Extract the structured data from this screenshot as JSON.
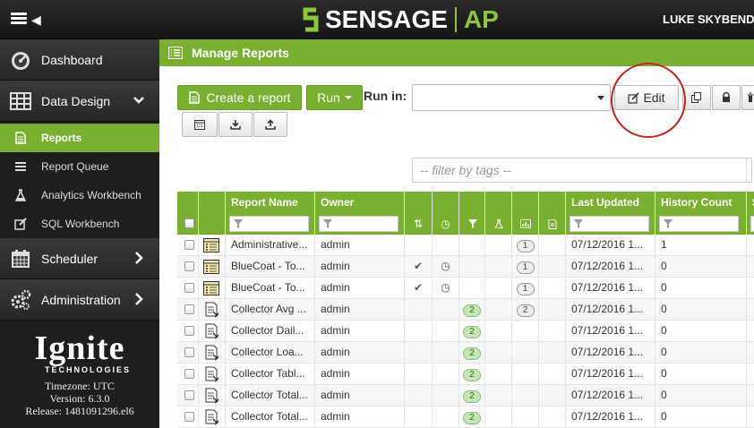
{
  "topbar": {
    "brand_main": "SENSAGE",
    "brand_suffix": "AP",
    "user_name": "LUKE SKYBENDER",
    "menu_icon": "hamburger-icon",
    "brand_color": "#8dc63f"
  },
  "sidebar": {
    "main_items": [
      {
        "label": "Dashboard",
        "icon": "speedometer-icon"
      },
      {
        "label": "Data Design",
        "icon": "table-icon"
      },
      {
        "label": "Scheduler",
        "icon": "calendar-icon"
      },
      {
        "label": "Administration",
        "icon": "cogs-icon"
      }
    ],
    "sub_items": [
      {
        "label": "Reports",
        "icon": "report-icon",
        "active": true
      },
      {
        "label": "Report Queue",
        "icon": "list-icon"
      },
      {
        "label": "Analytics Workbench",
        "icon": "flask-icon"
      },
      {
        "label": "SQL Workbench",
        "icon": "edit-icon"
      }
    ],
    "brand_name": "Ignite",
    "brand_sub": "TECHNOLOGIES",
    "timezone": "Timezone: UTC",
    "version": "Version: 6.3.0",
    "release": "Release: 1481091296.el6"
  },
  "panel": {
    "title": "Manage Reports",
    "create_label": "Create a report",
    "run_label": "Run",
    "run_in_label": "Run in:",
    "edit_label": "Edit",
    "tag_placeholder": "-- filter by tags --",
    "accent_color": "#7ab030",
    "highlight_color": "#c0281e"
  },
  "table": {
    "columns": [
      "",
      "",
      "Report Name",
      "Owner",
      "",
      "",
      "",
      "",
      "",
      "",
      "Last Updated",
      "History Count",
      "S"
    ],
    "rows": [
      {
        "icon": "report-type-table-icon",
        "name": "Administrative...",
        "owner": "admin",
        "check": "",
        "clock": "",
        "badge_filter": "",
        "badge_chart": "1",
        "updated": "07/12/2016 1...",
        "history": "1"
      },
      {
        "icon": "report-type-table-icon",
        "name": "BlueCoat - To...",
        "owner": "admin",
        "check": "✔",
        "clock": "◷",
        "badge_filter": "",
        "badge_chart": "1",
        "updated": "07/12/2016 1...",
        "history": "0"
      },
      {
        "icon": "report-type-table-icon",
        "name": "BlueCoat - To...",
        "owner": "admin",
        "check": "✔",
        "clock": "◷",
        "badge_filter": "",
        "badge_chart": "1",
        "updated": "07/12/2016 1...",
        "history": "0"
      },
      {
        "icon": "report-type-doc-icon",
        "name": "Collector Avg ...",
        "owner": "admin",
        "check": "",
        "clock": "",
        "badge_filter": "2",
        "badge_chart": "2",
        "updated": "07/12/2016 1...",
        "history": "0"
      },
      {
        "icon": "report-type-doc-icon",
        "name": "Collector Dail...",
        "owner": "admin",
        "check": "",
        "clock": "",
        "badge_filter": "2",
        "badge_chart": "",
        "updated": "07/12/2016 1...",
        "history": "0"
      },
      {
        "icon": "report-type-doc-icon",
        "name": "Collector Loa...",
        "owner": "admin",
        "check": "",
        "clock": "",
        "badge_filter": "2",
        "badge_chart": "",
        "updated": "07/12/2016 1...",
        "history": "0"
      },
      {
        "icon": "report-type-doc-icon",
        "name": "Collector Tabl...",
        "owner": "admin",
        "check": "",
        "clock": "",
        "badge_filter": "2",
        "badge_chart": "",
        "updated": "07/12/2016 1...",
        "history": "0"
      },
      {
        "icon": "report-type-doc-icon",
        "name": "Collector Total...",
        "owner": "admin",
        "check": "",
        "clock": "",
        "badge_filter": "2",
        "badge_chart": "",
        "updated": "07/12/2016 1...",
        "history": "0"
      },
      {
        "icon": "report-type-doc-icon",
        "name": "Collector Total...",
        "owner": "admin",
        "check": "",
        "clock": "",
        "badge_filter": "2",
        "badge_chart": "",
        "updated": "07/12/2016 1...",
        "history": "0"
      }
    ]
  }
}
